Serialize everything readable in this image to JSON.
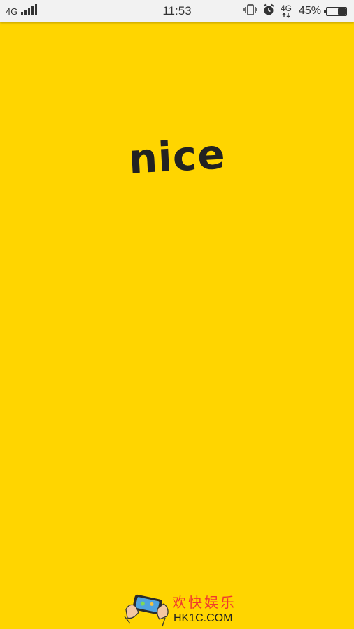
{
  "status_bar": {
    "network_left": "4G",
    "time": "11:53",
    "network_right": "4G",
    "battery_percent": "45%",
    "battery_level": 0.45,
    "icons": {
      "signal": "signal-bars-icon",
      "vibrate": "vibrate-icon",
      "alarm": "alarm-clock-icon",
      "network": "mobile-data-icon",
      "battery": "battery-icon"
    }
  },
  "splash": {
    "logo_text": "nice"
  },
  "watermark": {
    "brand_cn": "欢快娱乐",
    "url": "HK1C.COM"
  },
  "colors": {
    "background": "#FFD500",
    "logo": "#222222",
    "watermark_cn": "#F03A2E"
  }
}
